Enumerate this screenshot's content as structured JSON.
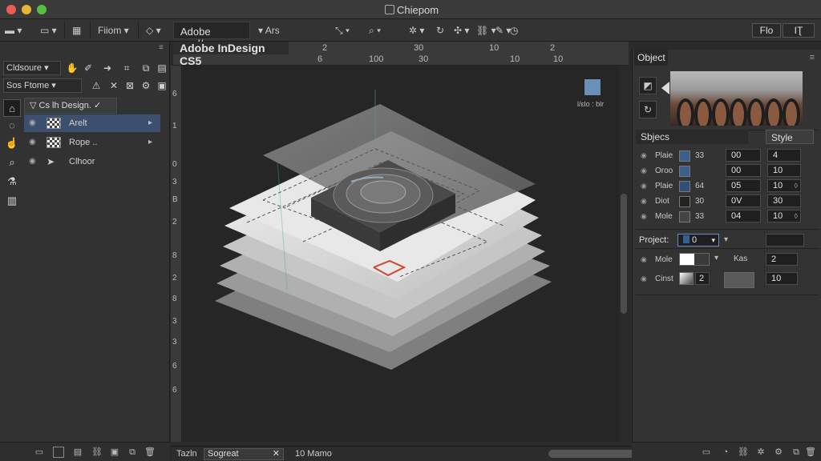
{
  "window": {
    "title": "Chiepom",
    "traffic_lights": {
      "close": "#ee5b55",
      "minimize": "#e8b530",
      "zoom": "#53c13f"
    }
  },
  "toolbar": {
    "menu1": "Fiiom",
    "tab": "Adobe goal/cs",
    "menu2": "Ars",
    "right_btn1": "Flo",
    "right_btn2": "IƮ"
  },
  "left_panel": {
    "dropdown1": "Cldsoure",
    "dropdown2": "Sos Ftome",
    "layer_group": "Cs lh Design.",
    "layers": [
      {
        "label": "Arelt",
        "selected": true
      },
      {
        "label": "Rope ..",
        "selected": false
      },
      {
        "label": "Clhoor",
        "selected": false
      }
    ]
  },
  "document": {
    "tab_title": "Adobe InDesign CS5",
    "ruler_h": [
      "6",
      "2",
      "100",
      "30",
      "30",
      "10",
      "10",
      "2",
      "10"
    ],
    "ruler_v": [
      "6",
      "1",
      "0",
      "3",
      "B",
      "2",
      "8",
      "2",
      "8",
      "3",
      "3",
      "6",
      "6"
    ],
    "canvas_icon_label": "l/ɛlo : blr"
  },
  "status_bar": {
    "item1": "Tazln",
    "field": "Sogreat",
    "item2": "10 Mamo"
  },
  "right_panel": {
    "title": "Object",
    "subtab1": "Sbjecs",
    "subtab2": "Style",
    "rows": [
      {
        "label": "Plaie",
        "name": "33",
        "v1": "00",
        "v2": "4"
      },
      {
        "label": "Oroo",
        "name": "",
        "v1": "00",
        "v2": "10"
      },
      {
        "label": "Plaie",
        "name": "64",
        "v1": "05",
        "v2": "10"
      },
      {
        "label": "Diot",
        "name": "30",
        "v1": "0V",
        "v2": "30"
      },
      {
        "label": "Mole",
        "name": "33",
        "v1": "04",
        "v2": "10"
      }
    ],
    "project_label": "Project:",
    "project_value": "0",
    "mode_label": "Mole",
    "mode_field_label": "Kas",
    "mode_value": "2",
    "cinst_label": "Cinst",
    "cinst_value": "2",
    "cinst_field": "10"
  }
}
